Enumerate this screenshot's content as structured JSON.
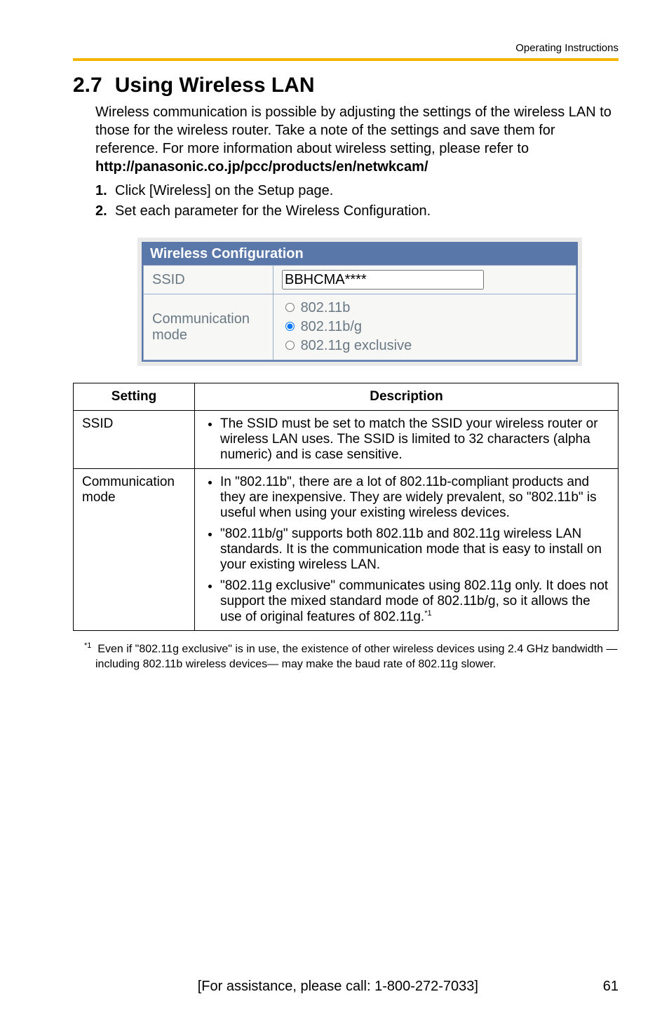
{
  "header": {
    "running_title": "Operating Instructions"
  },
  "title": {
    "number": "2.7",
    "text": "Using Wireless LAN"
  },
  "intro": {
    "text": "Wireless communication is possible by adjusting the settings of the wireless LAN to those for the wireless router. Take a note of the settings and save them for reference. For more information about wireless setting, please refer to ",
    "link": "http://panasonic.co.jp/pcc/products/en/netwkcam/"
  },
  "steps": [
    {
      "num": "1.",
      "text": "Click [Wireless] on the Setup page."
    },
    {
      "num": "2.",
      "text": "Set each parameter for the Wireless Configuration."
    }
  ],
  "wireless_config": {
    "heading": "Wireless Configuration",
    "rows": {
      "ssid": {
        "label": "SSID",
        "value": "BBHCMA****"
      },
      "comm": {
        "label": "Communication mode",
        "options": [
          "802.11b",
          "802.11b/g",
          "802.11g exclusive"
        ],
        "selected_index": 1
      }
    }
  },
  "desc_table": {
    "headers": {
      "setting": "Setting",
      "description": "Description"
    },
    "rows": [
      {
        "setting": "SSID",
        "bullets": [
          "The SSID must be set to match the SSID your wireless router or wireless LAN uses. The SSID is limited to 32 characters (alpha numeric) and is case sensitive."
        ]
      },
      {
        "setting": "Communication mode",
        "bullets": [
          "In \"802.11b\", there are a lot of 802.11b-compliant products and they are inexpensive. They are widely prevalent, so \"802.11b\" is useful when using your existing wireless devices.",
          "\"802.11b/g\" supports both 802.11b and 802.11g wireless LAN standards. It is the communication mode that is easy to install on your existing wireless LAN.",
          "\"802.11g exclusive\" communicates using 802.11g only. It does not support the mixed standard mode of 802.11b/g, so it allows the use of original features of 802.11g."
        ],
        "trailing_sup_on_last": "*1"
      }
    ]
  },
  "footnote": {
    "marker": "*1",
    "text": "Even if \"802.11g exclusive\" is in use, the existence of other wireless devices using 2.4 GHz bandwidth —including 802.11b wireless devices— may make the baud rate of 802.11g slower."
  },
  "footer": {
    "assist": "[For assistance, please call: 1-800-272-7033]",
    "page": "61"
  }
}
